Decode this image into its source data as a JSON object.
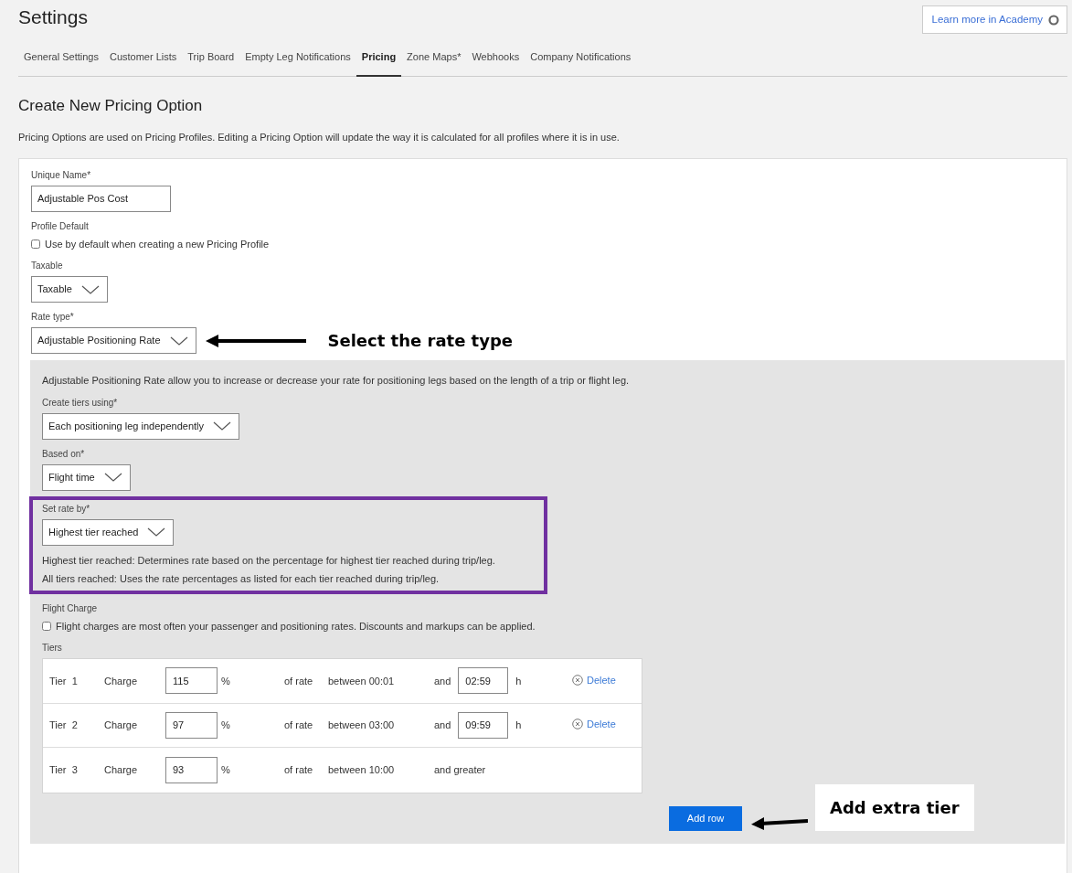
{
  "header": {
    "title": "Settings",
    "academy_link": "Learn more in Academy"
  },
  "tabs": [
    {
      "label": "General Settings",
      "selected": false
    },
    {
      "label": "Customer Lists",
      "selected": false
    },
    {
      "label": "Trip Board",
      "selected": false
    },
    {
      "label": "Empty Leg Notifications",
      "selected": false
    },
    {
      "label": "Pricing",
      "selected": true
    },
    {
      "label": "Zone Maps*",
      "selected": false
    },
    {
      "label": "Webhooks",
      "selected": false
    },
    {
      "label": "Company Notifications",
      "selected": false
    }
  ],
  "section": {
    "title": "Create New Pricing Option",
    "description": "Pricing Options are used on Pricing Profiles. Editing a Pricing Option will update the way it is calculated for all profiles where it is in use."
  },
  "form": {
    "unique_name": {
      "label": "Unique Name*",
      "value": "Adjustable Pos Cost"
    },
    "profile_default": {
      "label": "Profile Default",
      "checkbox_label": "Use by default when creating a new Pricing Profile",
      "checked": false
    },
    "taxable": {
      "label": "Taxable",
      "value": "Taxable"
    },
    "rate_type": {
      "label": "Rate type*",
      "value": "Adjustable Positioning Rate"
    }
  },
  "rate_panel": {
    "description": "Adjustable Positioning Rate allow you to increase or decrease your rate for positioning legs based on the length of a trip or flight leg.",
    "create_tiers_using": {
      "label": "Create tiers using*",
      "value": "Each positioning leg independently"
    },
    "based_on": {
      "label": "Based on*",
      "value": "Flight time"
    },
    "set_rate_by": {
      "label": "Set rate by*",
      "value": "Highest tier reached",
      "help": [
        "Highest tier reached: Determines rate based on the percentage for highest tier reached during trip/leg.",
        "All tiers reached: Uses the rate percentages as listed for each tier reached during trip/leg."
      ]
    },
    "flight_charge": {
      "label": "Flight Charge",
      "checkbox_label": "Flight charges are most often your passenger and positioning rates. Discounts and markups can be applied.",
      "checked": false
    },
    "tiers_label": "Tiers",
    "tiers": [
      {
        "tier": "Tier  1",
        "charge": "Charge",
        "percent": "115",
        "percent_unit": "%",
        "of_rate": "of rate",
        "between": "between 00:01",
        "and": "and",
        "until": "02:59",
        "unit": "h",
        "delete": "Delete"
      },
      {
        "tier": "Tier  2",
        "charge": "Charge",
        "percent": "97",
        "percent_unit": "%",
        "of_rate": "of rate",
        "between": "between 03:00",
        "and": "and",
        "until": "09:59",
        "unit": "h",
        "delete": "Delete"
      },
      {
        "tier": "Tier  3",
        "charge": "Charge",
        "percent": "93",
        "percent_unit": "%",
        "of_rate": "of rate",
        "between": "between 10:00",
        "and": "and greater"
      }
    ],
    "add_row": "Add row"
  },
  "annotations": [
    {
      "text": "Select the rate type"
    },
    {
      "text": "Add extra tier"
    }
  ]
}
